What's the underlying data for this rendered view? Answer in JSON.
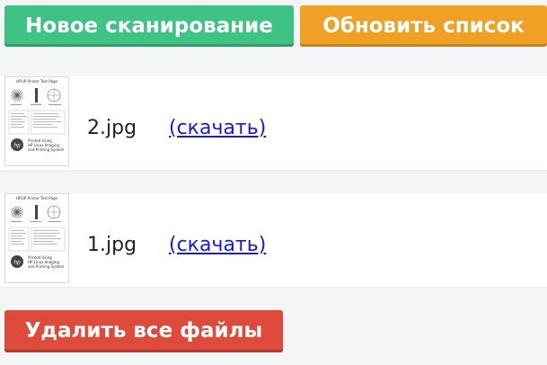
{
  "toolbar": {
    "new_scan_label": "Новое сканирование",
    "refresh_list_label": "Обновить список"
  },
  "files": [
    {
      "name": "2.jpg",
      "download_label": "(скачать)",
      "thumbnail": {
        "title": "HPLIP Printer Test Page",
        "caption_lines": [
          "Printed Using",
          "HP Linux Imaging",
          "and Printing System"
        ]
      }
    },
    {
      "name": "1.jpg",
      "download_label": "(скачать)",
      "thumbnail": {
        "title": "HPLIP Printer Test Page",
        "caption_lines": [
          "Printed Using",
          "HP Linux Imaging",
          "and Printing System"
        ]
      }
    }
  ],
  "footer": {
    "delete_all_label": "Удалить все файлы"
  },
  "colors": {
    "new_scan_button": "#3ec384",
    "refresh_button": "#f0a024",
    "delete_button": "#de4b3c",
    "link": "#1a1ad6"
  }
}
